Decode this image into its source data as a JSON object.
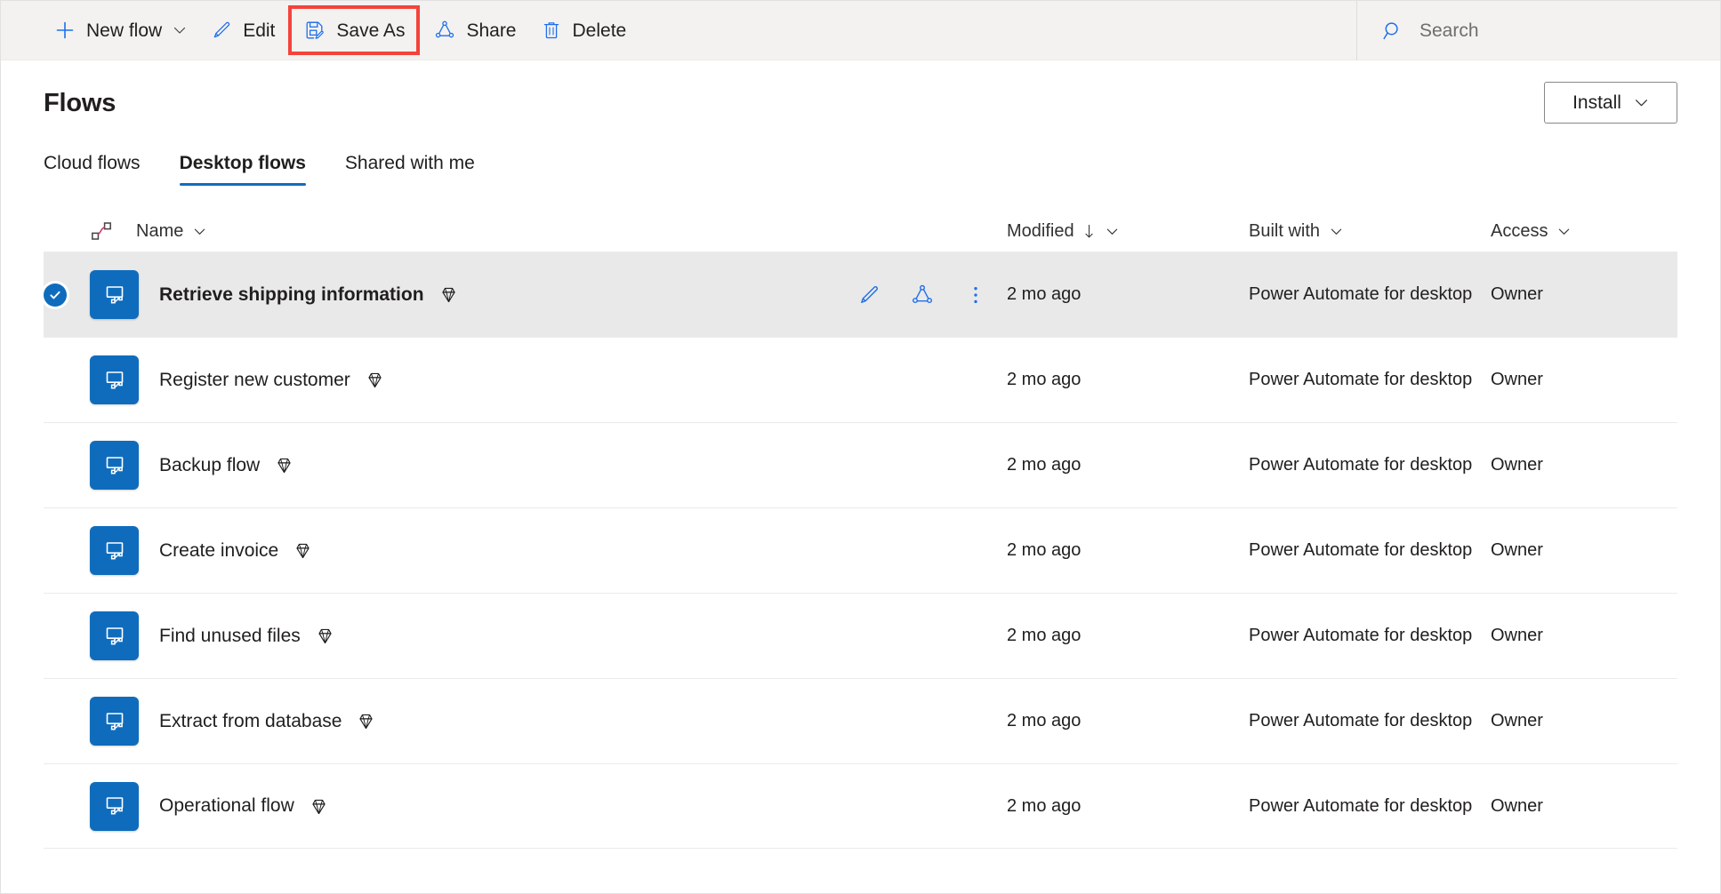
{
  "commandbar": {
    "items": [
      {
        "label": "New flow",
        "icon": "plus-icon",
        "has_chevron": true
      },
      {
        "label": "Edit",
        "icon": "pencil-icon",
        "has_chevron": false
      },
      {
        "label": "Save As",
        "icon": "save-as-icon",
        "has_chevron": false,
        "highlighted": true
      },
      {
        "label": "Share",
        "icon": "share-icon",
        "has_chevron": false
      },
      {
        "label": "Delete",
        "icon": "trash-icon",
        "has_chevron": false
      }
    ],
    "search": {
      "placeholder": "Search",
      "value": "",
      "icon": "search-icon"
    },
    "highlight_color": "#f4433a",
    "accent_color": "#1f6feb",
    "background": "#f3f2f1"
  },
  "header": {
    "title": "Flows",
    "install_button": {
      "label": "Install",
      "icon": "chevron-down-icon"
    }
  },
  "tabs": [
    {
      "label": "Cloud flows",
      "active": false
    },
    {
      "label": "Desktop flows",
      "active": true
    },
    {
      "label": "Shared with me",
      "active": false
    }
  ],
  "table": {
    "columns": {
      "link_icon": "connection-icon",
      "name": {
        "label": "Name",
        "sorted": false
      },
      "modified": {
        "label": "Modified",
        "sorted": true,
        "sort_direction": "down"
      },
      "built_with": {
        "label": "Built with",
        "sorted": false
      },
      "access": {
        "label": "Access",
        "sorted": false
      }
    },
    "row_actions": [
      {
        "name": "edit",
        "icon": "pencil-icon"
      },
      {
        "name": "share",
        "icon": "share-icon"
      },
      {
        "name": "more",
        "icon": "more-vertical-icon"
      }
    ],
    "rows": [
      {
        "selected": true,
        "icon": "desktop-flow-icon",
        "name": "Retrieve shipping information",
        "premium": true,
        "modified": "2 mo ago",
        "built_with": "Power Automate for desktop",
        "access": "Owner"
      },
      {
        "selected": false,
        "icon": "desktop-flow-icon",
        "name": "Register new customer",
        "premium": true,
        "modified": "2 mo ago",
        "built_with": "Power Automate for desktop",
        "access": "Owner"
      },
      {
        "selected": false,
        "icon": "desktop-flow-icon",
        "name": "Backup flow",
        "premium": true,
        "modified": "2 mo ago",
        "built_with": "Power Automate for desktop",
        "access": "Owner"
      },
      {
        "selected": false,
        "icon": "desktop-flow-icon",
        "name": "Create invoice",
        "premium": true,
        "modified": "2 mo ago",
        "built_with": "Power Automate for desktop",
        "access": "Owner"
      },
      {
        "selected": false,
        "icon": "desktop-flow-icon",
        "name": "Find unused files",
        "premium": true,
        "modified": "2 mo ago",
        "built_with": "Power Automate for desktop",
        "access": "Owner"
      },
      {
        "selected": false,
        "icon": "desktop-flow-icon",
        "name": "Extract from database",
        "premium": true,
        "modified": "2 mo ago",
        "built_with": "Power Automate for desktop",
        "access": "Owner"
      },
      {
        "selected": false,
        "icon": "desktop-flow-icon",
        "name": "Operational flow",
        "premium": true,
        "modified": "2 mo ago",
        "built_with": "Power Automate for desktop",
        "access": "Owner"
      }
    ]
  },
  "colors": {
    "brand_blue": "#0f6cbd",
    "icon_blue": "#1f6feb",
    "selected_row": "#e9e9e9",
    "highlight_red": "#f4433a"
  }
}
